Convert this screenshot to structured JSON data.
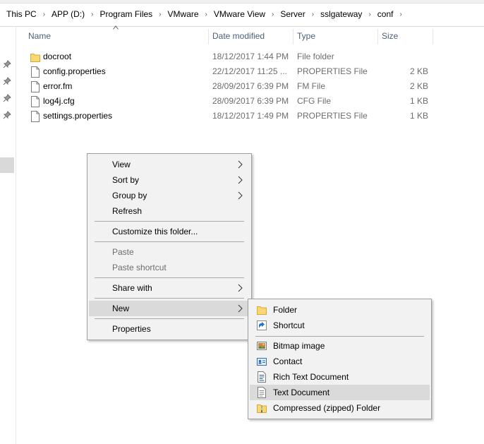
{
  "breadcrumbs": [
    "This PC",
    "APP (D:)",
    "Program Files",
    "VMware",
    "VMware View",
    "Server",
    "sslgateway",
    "conf"
  ],
  "columns": {
    "name": "Name",
    "date": "Date modified",
    "type": "Type",
    "size": "Size"
  },
  "files": [
    {
      "name": "docroot",
      "date": "18/12/2017 1:44 PM",
      "type": "File folder",
      "size": "",
      "icon": "folder-icon"
    },
    {
      "name": "config.properties",
      "date": "22/12/2017 11:25 ...",
      "type": "PROPERTIES File",
      "size": "2 KB",
      "icon": "file-icon"
    },
    {
      "name": "error.fm",
      "date": "28/09/2017 6:39 PM",
      "type": "FM File",
      "size": "2 KB",
      "icon": "file-icon"
    },
    {
      "name": "log4j.cfg",
      "date": "28/09/2017 6:39 PM",
      "type": "CFG File",
      "size": "1 KB",
      "icon": "file-icon"
    },
    {
      "name": "settings.properties",
      "date": "18/12/2017 1:49 PM",
      "type": "PROPERTIES File",
      "size": "1 KB",
      "icon": "file-icon"
    }
  ],
  "context_menu": {
    "view": "View",
    "sort_by": "Sort by",
    "group_by": "Group by",
    "refresh": "Refresh",
    "customize": "Customize this folder...",
    "paste": "Paste",
    "paste_shortcut": "Paste shortcut",
    "share_with": "Share with",
    "new": "New",
    "properties": "Properties"
  },
  "new_submenu": {
    "folder": "Folder",
    "shortcut": "Shortcut",
    "bitmap": "Bitmap image",
    "contact": "Contact",
    "rtf": "Rich Text Document",
    "text": "Text Document",
    "zip": "Compressed (zipped) Folder"
  },
  "colors": {
    "folder": "#f8d775",
    "highlight": "#dadada",
    "header_text": "#4c607a"
  }
}
